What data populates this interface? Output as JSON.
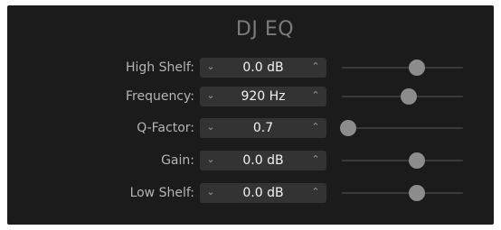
{
  "title": "DJ EQ",
  "colors": {
    "panel_background": "#1b1b1b",
    "stepper_background": "#333333",
    "label_text": "#b5b5b5",
    "value_text": "#f2f2f2",
    "slider_track": "#3a3a3a",
    "slider_knob": "#8c8c8c"
  },
  "icons": {
    "decrement": "chevron-down-icon",
    "increment": "chevron-up-icon"
  },
  "rows": [
    {
      "label": "High Shelf:",
      "value": "0.0 dB",
      "slider_level": 0.62
    },
    {
      "label": "Frequency:",
      "value": "920 Hz",
      "slider_level": 0.55
    },
    {
      "label": "Q-Factor:",
      "value": "0.7",
      "slider_level": 0.05
    },
    {
      "label": "Gain:",
      "value": "0.0 dB",
      "slider_level": 0.62
    },
    {
      "label": "Low Shelf:",
      "value": "0.0 dB",
      "slider_level": 0.62
    }
  ]
}
